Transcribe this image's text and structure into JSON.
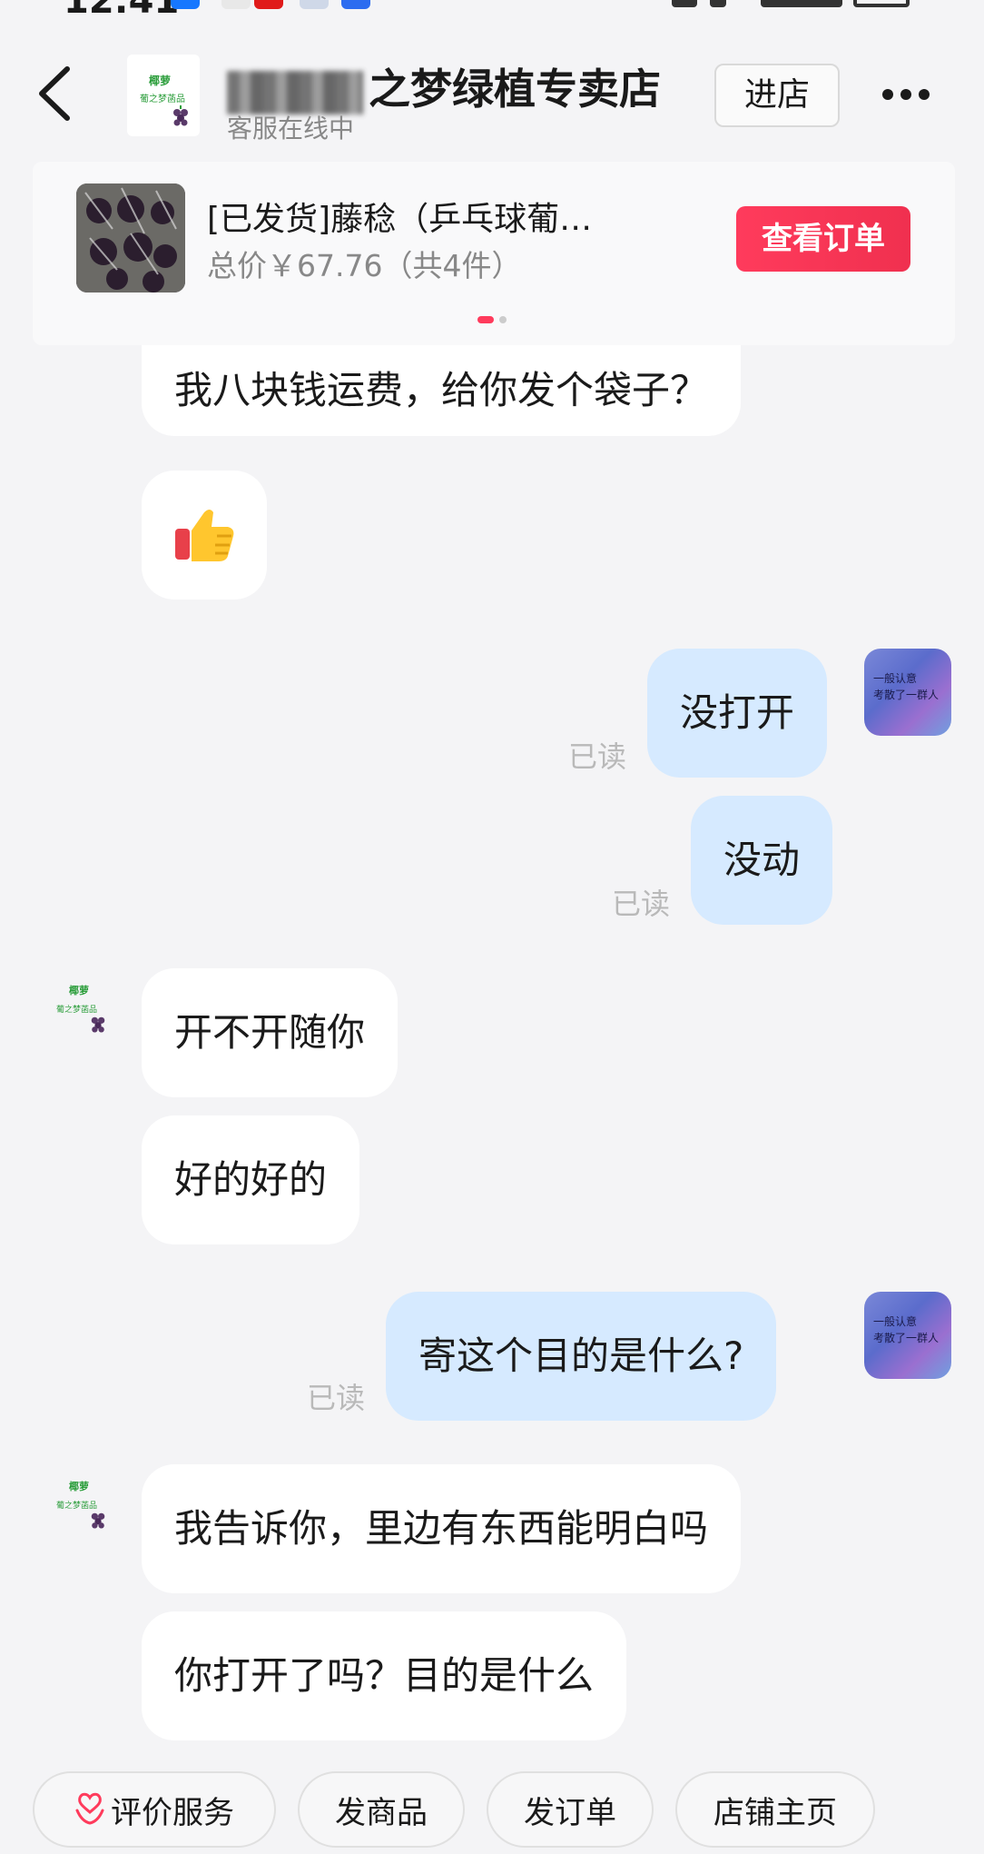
{
  "header": {
    "store_name": "之梦绿植专卖店",
    "store_status": "客服在线中",
    "enter_store_label": "进店",
    "avatar_line1": "椰萝",
    "avatar_line2": "葡之梦菡品"
  },
  "order": {
    "title": "[已发货]藤稔（乒乓球葡…",
    "price": "总价￥67.76（共4件）",
    "view_order_label": "查看订单"
  },
  "messages": [
    {
      "side": "in",
      "text": "我八块钱运费，给你发个袋子？"
    },
    {
      "side": "in",
      "text": "👍"
    },
    {
      "side": "out",
      "text": "没打开",
      "read": "已读"
    },
    {
      "side": "out",
      "text": "没动",
      "read": "已读"
    },
    {
      "side": "in",
      "text": "开不开随你"
    },
    {
      "side": "in",
      "text": "好的好的"
    },
    {
      "side": "out",
      "text": "寄这个目的是什么?",
      "read": "已读"
    },
    {
      "side": "in",
      "text": "我告诉你，里边有东西能明白吗"
    },
    {
      "side": "in",
      "text": "你打开了吗？目的是什么"
    }
  ],
  "my_avatar_text": "一般认意\n考散了一群人",
  "quick_actions": [
    {
      "label": "评价服务",
      "icon": "heart-hands-icon"
    },
    {
      "label": "发商品"
    },
    {
      "label": "发订单"
    },
    {
      "label": "店铺主页"
    }
  ],
  "colors": {
    "accent": "#ff3b5c",
    "outgoing_bubble": "#d6eaff",
    "incoming_bubble": "#ffffff",
    "background": "#f4f4f6"
  }
}
